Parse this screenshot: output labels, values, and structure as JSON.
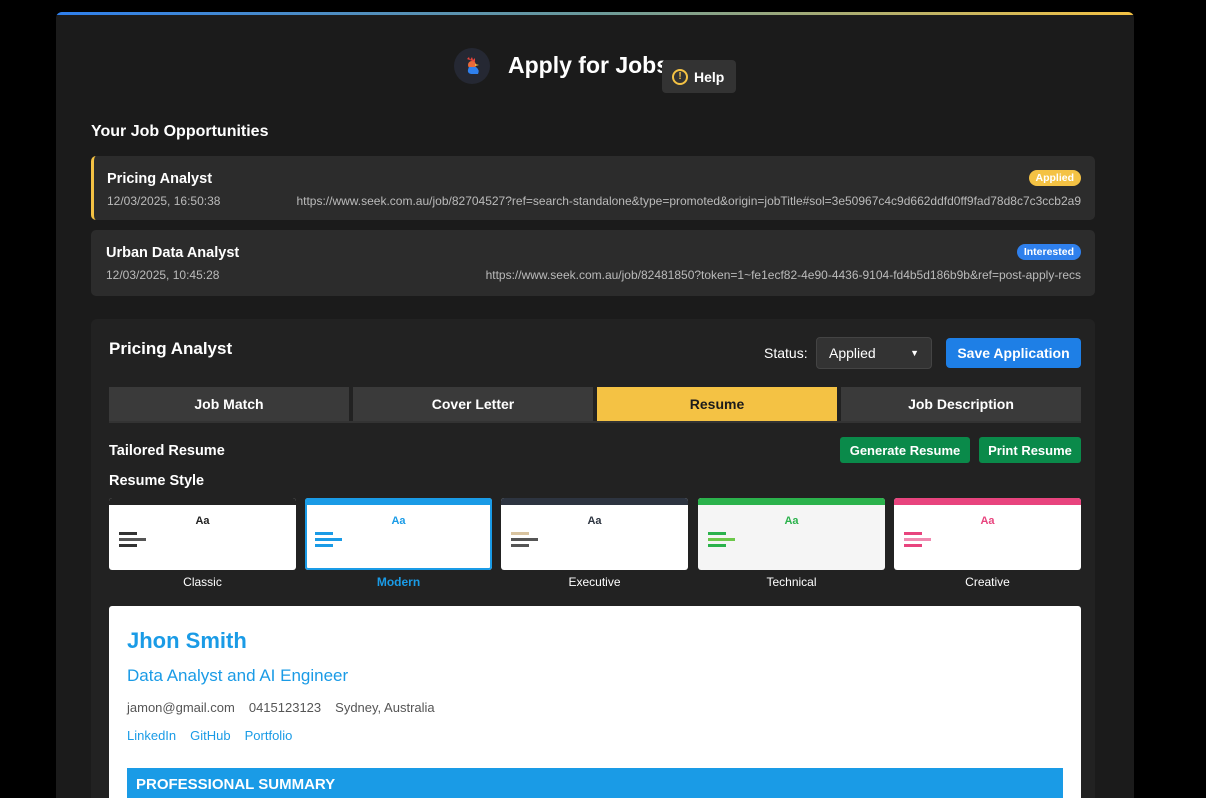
{
  "app": {
    "title": "Apply for Jobs",
    "help_label": "Help",
    "help_icon": "!"
  },
  "opportunities": {
    "heading": "Your Job Opportunities",
    "jobs": [
      {
        "title": "Pricing Analyst",
        "date": "12/03/2025, 16:50:38",
        "url": "https://www.seek.com.au/job/82704527?ref=search-standalone&type=promoted&origin=jobTitle#sol=3e50967c4c9d662ddfd0ff9fad78d8c7c3ccb2a9",
        "status": "Applied",
        "status_color": "#f4c244"
      },
      {
        "title": "Urban Data Analyst",
        "date": "12/03/2025, 10:45:28",
        "url": "https://www.seek.com.au/job/82481850?token=1~fe1ecf82-4e90-4436-9104-fd4b5d186b9b&ref=post-apply-recs",
        "status": "Interested",
        "status_color": "#2f80ed"
      }
    ]
  },
  "detail": {
    "title": "Pricing Analyst",
    "status_label": "Status:",
    "status_value": "Applied",
    "save_label": "Save Application",
    "tabs": [
      "Job Match",
      "Cover Letter",
      "Resume",
      "Job Description"
    ],
    "active_tab": "Resume",
    "tailored_title": "Tailored Resume",
    "generate_label": "Generate Resume",
    "print_label": "Print Resume",
    "style_title": "Resume Style",
    "styles": [
      {
        "label": "Classic",
        "sample": "Aa",
        "accent": "#222222"
      },
      {
        "label": "Modern",
        "sample": "Aa",
        "accent": "#1a9be6"
      },
      {
        "label": "Executive",
        "sample": "Aa",
        "accent": "#2d3440"
      },
      {
        "label": "Technical",
        "sample": "Aa",
        "accent": "#2bb24c"
      },
      {
        "label": "Creative",
        "sample": "Aa",
        "accent": "#e8447e"
      }
    ],
    "selected_style": "Modern"
  },
  "resume": {
    "name": "Jhon Smith",
    "role": "Data Analyst and AI Engineer",
    "email": "jamon@gmail.com",
    "phone": "0415123123",
    "location": "Sydney, Australia",
    "links": [
      "LinkedIn",
      "GitHub",
      "Portfolio"
    ],
    "section_heading": "PROFESSIONAL SUMMARY"
  }
}
